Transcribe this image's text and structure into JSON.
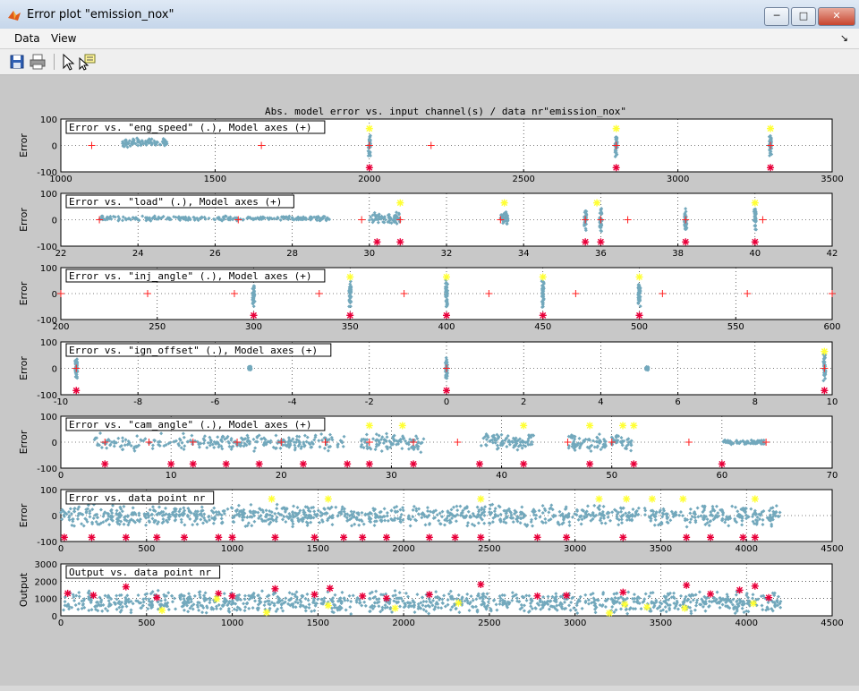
{
  "window": {
    "title": "Error plot \"emission_nox\"",
    "buttons": {
      "minimize": "─",
      "maximize": "□",
      "close": "✕"
    }
  },
  "menu": {
    "items": [
      "Data",
      "View"
    ],
    "dock_icon": "dock-arrow-icon"
  },
  "toolbar": {
    "buttons": [
      "save-icon",
      "print-icon",
      "pointer-icon",
      "data-cursor-icon"
    ]
  },
  "colors": {
    "points": "#72a8bc",
    "model_axes": "#ff2020",
    "low": "#e8003a",
    "high": "#ffff33"
  },
  "chart_data": {
    "title": "Abs. model error vs. input channel(s) / data nr\"emission_nox\"",
    "type": "scatter",
    "subplots": [
      {
        "legend": "Error vs. \"eng_speed\" (.), Model axes (+)",
        "ylabel": "Error",
        "xlim": [
          1000,
          3500
        ],
        "ylim": [
          -100,
          100
        ],
        "xticks": [
          1000,
          1500,
          2000,
          2500,
          3000,
          3500
        ],
        "yticks": [
          -100,
          0,
          100
        ],
        "clusters": [
          [
            1200,
            1350,
            10,
            18
          ],
          [
            2000,
            2000,
            0,
            45
          ],
          [
            2800,
            2800,
            0,
            45
          ],
          [
            3300,
            3300,
            0,
            45
          ]
        ],
        "model_axes_x": [
          1100,
          1650,
          2000,
          2200,
          2800,
          3300
        ],
        "low_x": [
          2000,
          2800,
          3300
        ],
        "high_x": [
          2000,
          2800,
          3300
        ]
      },
      {
        "legend": "Error vs. \"load\" (.), Model axes (+)",
        "ylabel": "Error",
        "xlim": [
          22,
          42
        ],
        "ylim": [
          -100,
          100
        ],
        "xticks": [
          22,
          24,
          26,
          28,
          30,
          32,
          34,
          36,
          38,
          40,
          42
        ],
        "yticks": [
          -100,
          0,
          100
        ],
        "clusters": [
          [
            23,
            29,
            5,
            10
          ],
          [
            30,
            30.8,
            5,
            25
          ],
          [
            33.4,
            33.6,
            5,
            25
          ],
          [
            35.6,
            35.6,
            0,
            50
          ],
          [
            36,
            36,
            0,
            50
          ],
          [
            38.2,
            38.2,
            0,
            45
          ],
          [
            40,
            40,
            0,
            50
          ]
        ],
        "model_axes_x": [
          23,
          26.6,
          29.8,
          30.8,
          33.4,
          35.6,
          36,
          36.7,
          38.2,
          40.2
        ],
        "low_x": [
          30.2,
          30.8,
          35.6,
          36,
          38.2,
          40
        ],
        "high_x": [
          30.8,
          33.5,
          35.9,
          40
        ]
      },
      {
        "legend": "Error vs. \"inj_angle\" (.), Model axes (+)",
        "ylabel": "Error",
        "xlim": [
          200,
          600
        ],
        "ylim": [
          -100,
          100
        ],
        "xticks": [
          200,
          250,
          300,
          350,
          400,
          450,
          500,
          550,
          600
        ],
        "yticks": [
          -100,
          0,
          100
        ],
        "clusters": [
          [
            300,
            300,
            0,
            60
          ],
          [
            350,
            350,
            0,
            60
          ],
          [
            400,
            400,
            0,
            60
          ],
          [
            450,
            450,
            0,
            60
          ],
          [
            500,
            500,
            0,
            60
          ]
        ],
        "model_axes_x": [
          200,
          245,
          290,
          334,
          378,
          422,
          467,
          512,
          556,
          600
        ],
        "low_x": [
          300,
          350,
          400,
          450,
          500
        ],
        "high_x": [
          350,
          400,
          450,
          500
        ]
      },
      {
        "legend": "Error vs. \"ign_offset\" (.), Model axes (+)",
        "ylabel": "Error",
        "xlim": [
          -10,
          10
        ],
        "ylim": [
          -100,
          100
        ],
        "xticks": [
          -10,
          -8,
          -6,
          -4,
          -2,
          0,
          2,
          4,
          6,
          8,
          10
        ],
        "yticks": [
          -100,
          0,
          100
        ],
        "clusters": [
          [
            -9.6,
            -9.6,
            0,
            40
          ],
          [
            -5.1,
            -5.1,
            0,
            8
          ],
          [
            0,
            0,
            0,
            50
          ],
          [
            5.2,
            5.2,
            0,
            8
          ],
          [
            9.8,
            9.8,
            0,
            55
          ]
        ],
        "model_axes_x": [
          -9.6,
          0,
          9.8
        ],
        "low_x": [
          -9.6,
          0,
          9.8
        ],
        "high_x": [
          9.8
        ]
      },
      {
        "legend": "Error vs. \"cam_angle\" (.), Model axes (+)",
        "ylabel": "Error",
        "xlim": [
          0,
          70
        ],
        "ylim": [
          -100,
          100
        ],
        "xticks": [
          0,
          10,
          20,
          30,
          40,
          50,
          60,
          70
        ],
        "yticks": [
          -100,
          0,
          100
        ],
        "clusters": [
          [
            3,
            26,
            0,
            35
          ],
          [
            27,
            33,
            0,
            40
          ],
          [
            38,
            43,
            0,
            35
          ],
          [
            46,
            52,
            0,
            40
          ],
          [
            60,
            64,
            0,
            10
          ]
        ],
        "model_axes_x": [
          4,
          8,
          12,
          16,
          20,
          24,
          28,
          32,
          36,
          46,
          50,
          57,
          64
        ],
        "low_x": [
          4,
          10,
          12,
          15,
          18,
          22,
          26,
          28,
          32,
          38,
          42,
          48,
          52,
          60
        ],
        "high_x": [
          28,
          31,
          42,
          48,
          51,
          52
        ]
      },
      {
        "legend": "Error vs. data point nr",
        "ylabel": "Error",
        "xlim": [
          0,
          4500
        ],
        "ylim": [
          -100,
          100
        ],
        "xticks": [
          0,
          500,
          1000,
          1500,
          2000,
          2500,
          3000,
          3500,
          4000,
          4500
        ],
        "yticks": [
          -100,
          0,
          100
        ],
        "clusters": [
          [
            0,
            4200,
            0,
            45
          ]
        ],
        "model_axes_x": [],
        "low_x": [
          20,
          180,
          380,
          560,
          720,
          920,
          1000,
          1250,
          1480,
          1650,
          1760,
          1900,
          2150,
          2300,
          2450,
          2780,
          2950,
          3280,
          3650,
          3790,
          3980,
          4050
        ],
        "high_x": [
          1230,
          1560,
          2450,
          3140,
          3300,
          3450,
          3630,
          4050
        ]
      },
      {
        "legend": "Output vs. data point nr",
        "ylabel": "Output",
        "xlim": [
          0,
          4500
        ],
        "ylim": [
          0,
          3000
        ],
        "xticks": [
          0,
          500,
          1000,
          1500,
          2000,
          2500,
          3000,
          3500,
          4000,
          4500
        ],
        "yticks": [
          0,
          1000,
          2000,
          3000
        ],
        "clusters": [
          [
            0,
            4200,
            800,
            700
          ]
        ],
        "model_axes_x": [],
        "low_x": [
          40,
          190,
          380,
          560,
          920,
          1000,
          1250,
          1480,
          1570,
          1760,
          1900,
          2150,
          2450,
          2780,
          2950,
          3280,
          3650,
          3790,
          3960,
          4050,
          4130
        ],
        "high_x": [
          590,
          910,
          1200,
          1560,
          1950,
          2320,
          3200,
          3290,
          3420,
          3640,
          4040
        ]
      }
    ]
  }
}
